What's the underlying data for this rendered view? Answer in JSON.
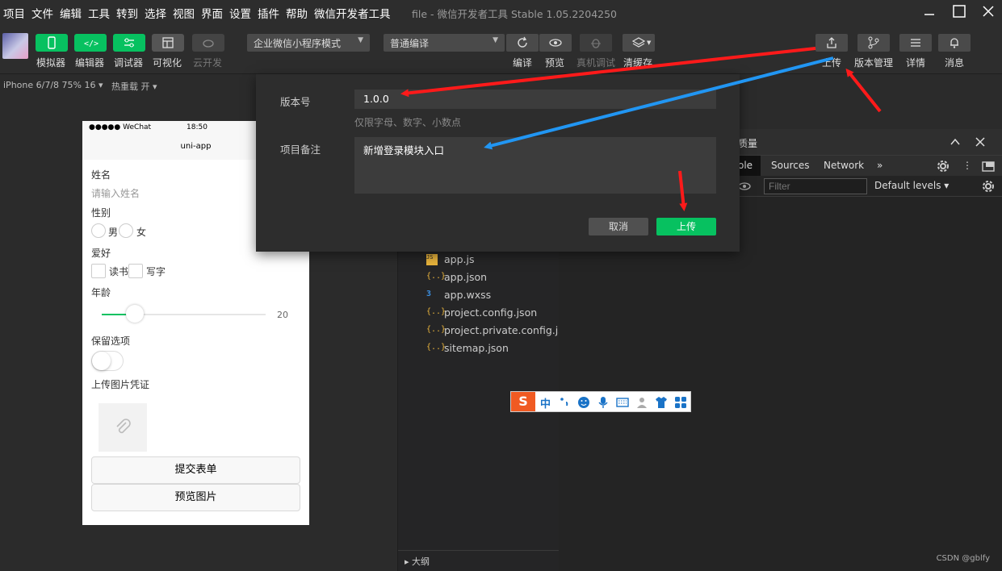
{
  "menubar": {
    "items": [
      "项目",
      "文件",
      "编辑",
      "工具",
      "转到",
      "选择",
      "视图",
      "界面",
      "设置",
      "插件",
      "帮助",
      "微信开发者工具"
    ],
    "title": "file - 微信开发者工具 Stable 1.05.2204250"
  },
  "toolbar": {
    "simulator": "模拟器",
    "editor": "编辑器",
    "debugger": "调试器",
    "visual": "可视化",
    "cloud": "云开发",
    "mode_select": "企业微信小程序模式",
    "compile_select": "普通编译",
    "compile": "编译",
    "preview": "预览",
    "remote_debug": "真机调试",
    "clear_cache": "清缓存",
    "upload": "上传",
    "version_mgmt": "版本管理",
    "details": "详情",
    "messages": "消息"
  },
  "subbar": {
    "device": "iPhone 6/7/8 75% 16 ▾",
    "hot_reload": "热重载 开 ▾"
  },
  "phone": {
    "status_left": "●●●●● WeChat",
    "status_time": "18:50",
    "nav_title": "uni-app",
    "name_label": "姓名",
    "name_placeholder": "请输入姓名",
    "gender_label": "性别",
    "gender_male": "男",
    "gender_female": "女",
    "hobby_label": "爱好",
    "hobby_read": "读书",
    "hobby_write": "写字",
    "age_label": "年龄",
    "age_value": "20",
    "age_fraction": 0.2,
    "keep_label": "保留选项",
    "upload_label": "上传图片凭证",
    "submit_button": "提交表单",
    "preview_button": "预览图片"
  },
  "tree": {
    "files": [
      {
        "icon": "JS",
        "name": "app.js"
      },
      {
        "icon": "{..}",
        "name": "app.json"
      },
      {
        "icon": "3",
        "name": "app.wxss"
      },
      {
        "icon": "{..}",
        "name": "project.config.json"
      },
      {
        "icon": "{..}",
        "name": "project.private.config.js..."
      },
      {
        "icon": "{..}",
        "name": "sitemap.json"
      }
    ],
    "outline": "▸ 大纲"
  },
  "devtools": {
    "panel_title": "质量",
    "tab_console": "ole",
    "tab_sources": "Sources",
    "tab_network": "Network",
    "more": "»",
    "filter_placeholder": "Filter",
    "levels": "Default levels ▾",
    "credit": "CSDN @gblfy"
  },
  "dialog": {
    "version_label": "版本号",
    "version_value": "1.0.0",
    "version_hint": "仅限字母、数字、小数点",
    "note_label": "项目备注",
    "note_value": "新增登录模块入口",
    "cancel": "取消",
    "upload": "上传"
  },
  "ime": {
    "logo": "S",
    "lang": "中"
  },
  "colors": {
    "accent_green": "#07c160",
    "arrow_red": "#ff1a1a",
    "arrow_blue": "#2196f3"
  }
}
